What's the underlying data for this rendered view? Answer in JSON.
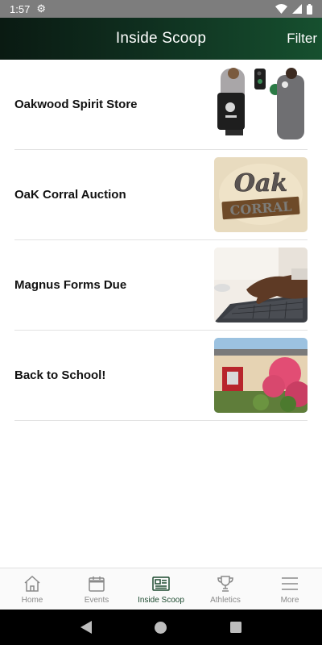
{
  "status_bar": {
    "time": "1:57"
  },
  "header": {
    "title": "Inside Scoop",
    "filter_label": "Filter"
  },
  "items": [
    {
      "title": "Oakwood Spirit Store",
      "image": "spirit-store-photo"
    },
    {
      "title": "OaK Corral Auction",
      "image": "oak-corral-sign"
    },
    {
      "title": "Magnus Forms Due",
      "image": "typing-laptop-photo"
    },
    {
      "title": "Back to School!",
      "image": "school-roses-photo"
    }
  ],
  "thumb_text": {
    "corral_top": "Oak",
    "corral_bottom": "CORRAL"
  },
  "nav": [
    {
      "label": "Home",
      "icon": "home-icon"
    },
    {
      "label": "Events",
      "icon": "calendar-icon"
    },
    {
      "label": "Inside Scoop",
      "icon": "newspaper-icon",
      "active": true
    },
    {
      "label": "Athletics",
      "icon": "trophy-icon"
    },
    {
      "label": "More",
      "icon": "menu-icon"
    }
  ],
  "colors": {
    "header_dark": "#0a1a12",
    "header_green": "#16502f",
    "active_nav": "#1d4a2f",
    "inactive_nav": "#8a8a8a"
  }
}
